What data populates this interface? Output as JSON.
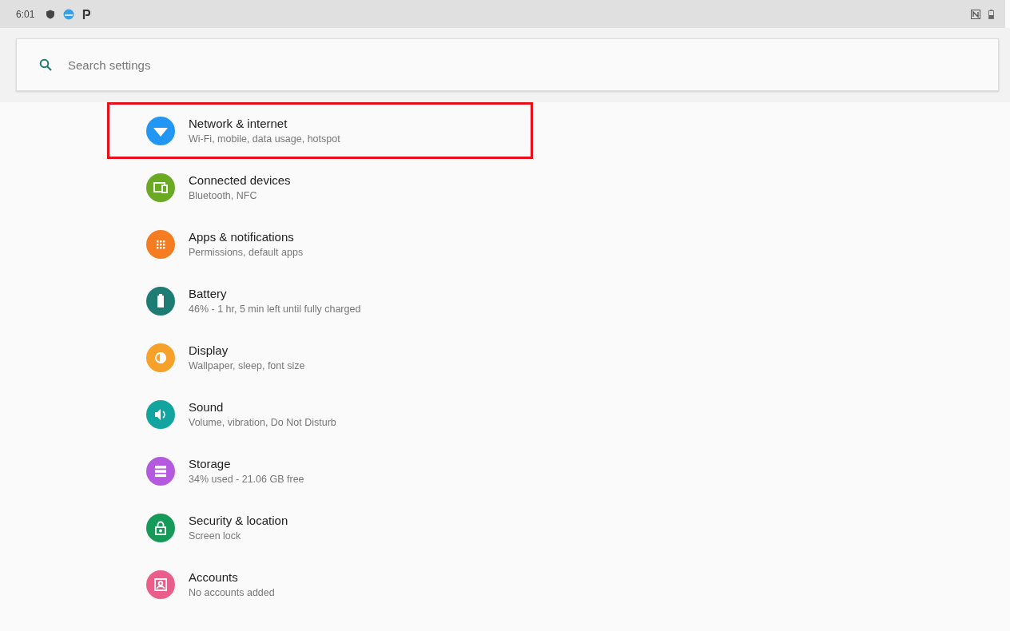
{
  "status_bar": {
    "time": "6:01"
  },
  "search": {
    "placeholder": "Search settings"
  },
  "items": [
    {
      "kind": "network",
      "title": "Network & internet",
      "summary": "Wi-Fi, mobile, data usage, hotspot",
      "color": "#2196f3",
      "highlighted": true
    },
    {
      "kind": "devices",
      "title": "Connected devices",
      "summary": "Bluetooth, NFC",
      "color": "#6aaa22",
      "highlighted": false
    },
    {
      "kind": "apps",
      "title": "Apps & notifications",
      "summary": "Permissions, default apps",
      "color": "#f57c20",
      "highlighted": false
    },
    {
      "kind": "battery",
      "title": "Battery",
      "summary": "46% - 1 hr, 5 min left until fully charged",
      "color": "#1d7d74",
      "highlighted": false
    },
    {
      "kind": "display",
      "title": "Display",
      "summary": "Wallpaper, sleep, font size",
      "color": "#f5a12a",
      "highlighted": false
    },
    {
      "kind": "sound",
      "title": "Sound",
      "summary": "Volume, vibration, Do Not Disturb",
      "color": "#12a5a0",
      "highlighted": false
    },
    {
      "kind": "storage",
      "title": "Storage",
      "summary": "34% used - 21.06 GB free",
      "color": "#b55ade",
      "highlighted": false
    },
    {
      "kind": "security",
      "title": "Security & location",
      "summary": "Screen lock",
      "color": "#169a5a",
      "highlighted": false
    },
    {
      "kind": "accounts",
      "title": "Accounts",
      "summary": "No accounts added",
      "color": "#eb5e8c",
      "highlighted": false
    }
  ]
}
